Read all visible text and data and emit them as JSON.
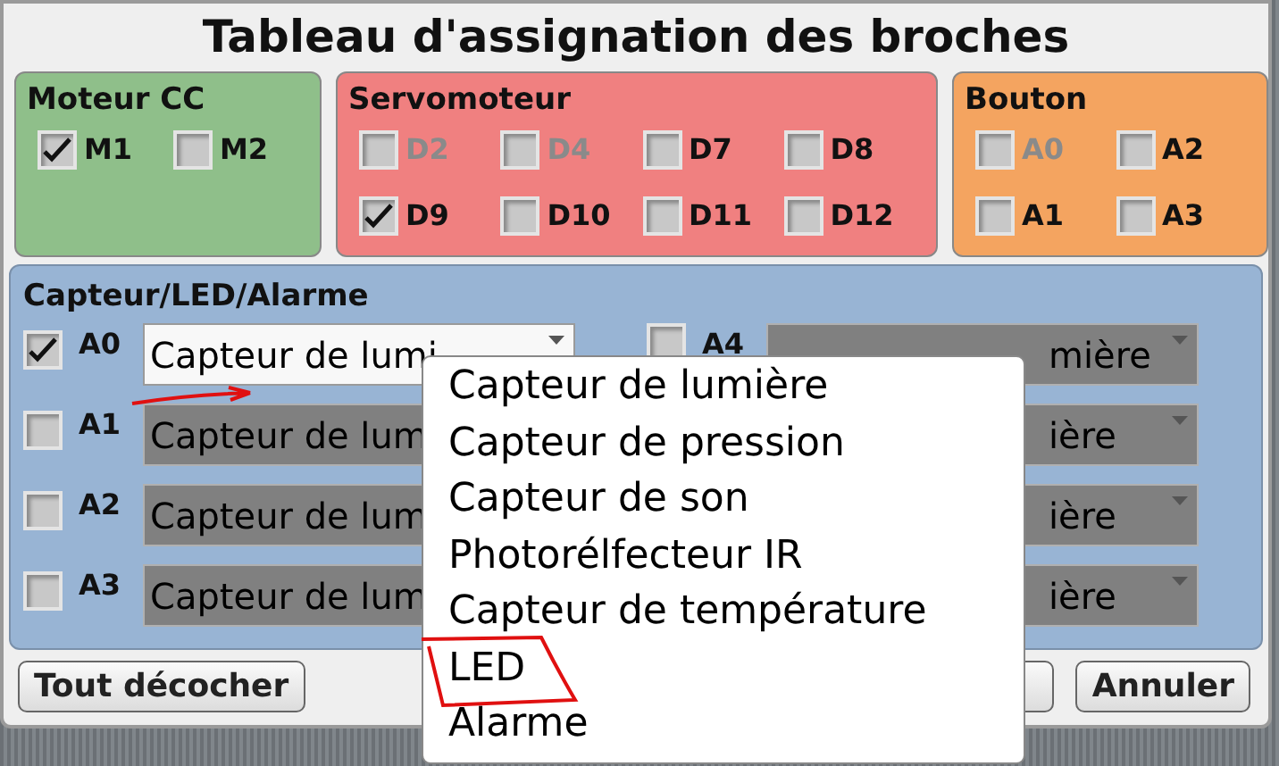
{
  "window": {
    "title": "Tableau d'assignation des broches"
  },
  "groups": [
    {
      "title": "Moteur CC",
      "color": "#8fbf8a",
      "pins": [
        {
          "label": "M1",
          "checked": true,
          "disabled": false
        },
        {
          "label": "M2",
          "checked": false,
          "disabled": false
        }
      ]
    },
    {
      "title": "Servomoteur",
      "color": "#f08080",
      "pins": [
        {
          "label": "D2",
          "checked": false,
          "disabled": true
        },
        {
          "label": "D4",
          "checked": false,
          "disabled": true
        },
        {
          "label": "D7",
          "checked": false,
          "disabled": false
        },
        {
          "label": "D8",
          "checked": false,
          "disabled": false
        },
        {
          "label": "D9",
          "checked": true,
          "disabled": false
        },
        {
          "label": "D10",
          "checked": false,
          "disabled": false
        },
        {
          "label": "D11",
          "checked": false,
          "disabled": false
        },
        {
          "label": "D12",
          "checked": false,
          "disabled": false
        }
      ]
    },
    {
      "title": "Bouton",
      "color": "#f4a460",
      "pins": [
        {
          "label": "A0",
          "checked": false,
          "disabled": true
        },
        {
          "label": "A2",
          "checked": false,
          "disabled": false
        },
        {
          "label": "A1",
          "checked": false,
          "disabled": false
        },
        {
          "label": "A3",
          "checked": false,
          "disabled": false
        }
      ]
    }
  ],
  "sensors": {
    "title": "Capteur/LED/Alarme",
    "left": [
      {
        "label": "A0",
        "checked": true,
        "value": "Capteur de lumi"
      },
      {
        "label": "A1",
        "checked": false,
        "value": "Capteur de lum"
      },
      {
        "label": "A2",
        "checked": false,
        "value": "Capteur de lum"
      },
      {
        "label": "A3",
        "checked": false,
        "value": "Capteur de lum"
      }
    ],
    "right": [
      {
        "label": "A4",
        "checked": false,
        "value": "mière"
      },
      {
        "value": "ière"
      },
      {
        "value": "ière"
      },
      {
        "value": "ière"
      }
    ]
  },
  "buttons": [
    {
      "kind": "uncheck",
      "label": "Tout décocher"
    },
    {
      "kind": "covered"
    },
    {
      "kind": "cancel",
      "label": "Annuler"
    }
  ],
  "dropdown": {
    "options": [
      "Capteur de lumière",
      "Capteur de pression",
      "Capteur de son",
      "Photorélfecteur IR",
      "Capteur de température",
      "LED",
      "Alarme"
    ]
  }
}
